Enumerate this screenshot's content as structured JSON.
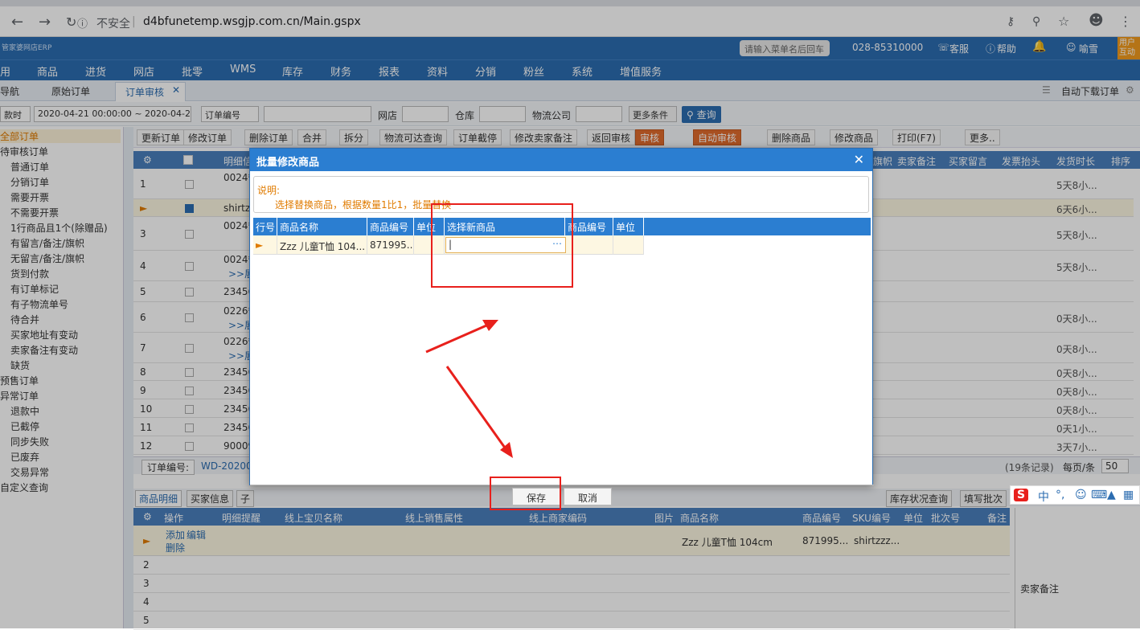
{
  "browser": {
    "insecure_label": "不安全",
    "url": "d4bfunetemp.wsgjp.com.cn/Main.gspx"
  },
  "header": {
    "logo": "管家婆网店ERP",
    "menu_search_placeholder": "请输入菜单名后回车",
    "phone": "028-85310000",
    "service": "客服",
    "help": "帮助",
    "user": "喻雪",
    "corner": "用户互动"
  },
  "nav": [
    "用",
    "商品",
    "进货",
    "网店",
    "批零",
    "WMS",
    "库存",
    "财务",
    "报表",
    "资料",
    "分销",
    "粉丝",
    "系统",
    "增值服务"
  ],
  "tabs": {
    "nav_tab": "导航",
    "raw_tab": "原始订单",
    "active_tab": "订单审核",
    "auto_download": "自动下载订单"
  },
  "filter": {
    "time_select": "款时",
    "date_range": "2020-04-21 00:00:00 ~ 2020-04-2",
    "order_no_select": "订单编号",
    "shop_label": "网店",
    "warehouse_label": "仓库",
    "logistics_label": "物流公司",
    "more_conditions": "更多条件",
    "query": "查询"
  },
  "tree": [
    "全部订单",
    "待审核订单",
    "普通订单",
    "分销订单",
    "需要开票",
    "不需要开票",
    "1行商品且1个(除赠品)",
    "有留言/备注/旗帜",
    "无留言/备注/旗帜",
    "货到付款",
    "有订单标记",
    "有子物流单号",
    "待合并",
    "买家地址有变动",
    "卖家备注有变动",
    "缺货",
    "预售订单",
    "异常订单",
    "退款中",
    "已截停",
    "同步失败",
    "已废弃",
    "交易异常",
    "自定义查询"
  ],
  "toolbar": [
    "更新订单",
    "修改订单",
    "删除订单",
    "合并",
    "拆分",
    "物流可达查询",
    "订单截停",
    "修改卖家备注",
    "返回审核",
    "审核",
    "自动审核",
    "删除商品",
    "修改商品",
    "打印(F7)",
    "更多.."
  ],
  "grid": {
    "headers": [
      "明细信",
      "旗帜",
      "卖家备注",
      "买家留言",
      "发票抬头",
      "发货时长",
      "排序"
    ],
    "rows": [
      {
        "n": "1",
        "m": "0024*",
        "t": "5天8小..."
      },
      {
        "n": "",
        "m": "shirtzz",
        "t": "6天6小..."
      },
      {
        "n": "3",
        "m": "0024*",
        "t": "5天8小..."
      },
      {
        "n": "4",
        "m": "0024*",
        "t": "5天8小..."
      },
      {
        "n": "5",
        "m": "23456",
        "t": ""
      },
      {
        "n": "6",
        "m": "0226*",
        "t": "0天8小..."
      },
      {
        "n": "7",
        "m": "0226*",
        "t": "0天8小..."
      },
      {
        "n": "8",
        "m": "23456",
        "t": "0天8小..."
      },
      {
        "n": "9",
        "m": "23456",
        "t": "0天8小..."
      },
      {
        "n": "10",
        "m": "23456",
        "t": "0天8小..."
      },
      {
        "n": "11",
        "m": "23456",
        "t": "0天1小..."
      },
      {
        "n": "12",
        "m": "90009",
        "t": "3天7小..."
      }
    ],
    "expand": ">>展"
  },
  "status": {
    "order_no_label": "订单编号:",
    "order_no": "WD-202004",
    "count": "(19条记录)",
    "per_page_label": "每页/条",
    "per_page": "50"
  },
  "bottom": {
    "tabs": [
      "商品明细",
      "买家信息",
      "子"
    ],
    "right_buttons": [
      "库存状况查询",
      "填写批次"
    ],
    "headers": [
      "操作",
      "明细提醒",
      "线上宝贝名称",
      "线上销售属性",
      "线上商家编码",
      "图片",
      "商品名称",
      "商品编号",
      "SKU编号",
      "单位",
      "批次号",
      "备注"
    ],
    "row1": {
      "add": "添加",
      "edit": "编辑",
      "del": "删除",
      "name": "Zzz 儿童T恤 104cm",
      "code": "871995...",
      "sku": "shirtzzz..."
    },
    "rows": [
      "2",
      "3",
      "4",
      "5"
    ],
    "seller_note": "卖家备注"
  },
  "dialog": {
    "title": "批量修改商品",
    "note_head": "说明:",
    "note_body": "选择替换商品，根据数量1比1，批量替换",
    "headers": [
      "行号",
      "商品名称",
      "商品编号",
      "单位",
      "选择新商品",
      "商品编号",
      "单位"
    ],
    "row": {
      "name": "Zzz 儿童T恤 104...",
      "code": "871995..."
    },
    "save": "保存",
    "cancel": "取消"
  },
  "ime": {
    "logo": "S",
    "lang": "中"
  }
}
